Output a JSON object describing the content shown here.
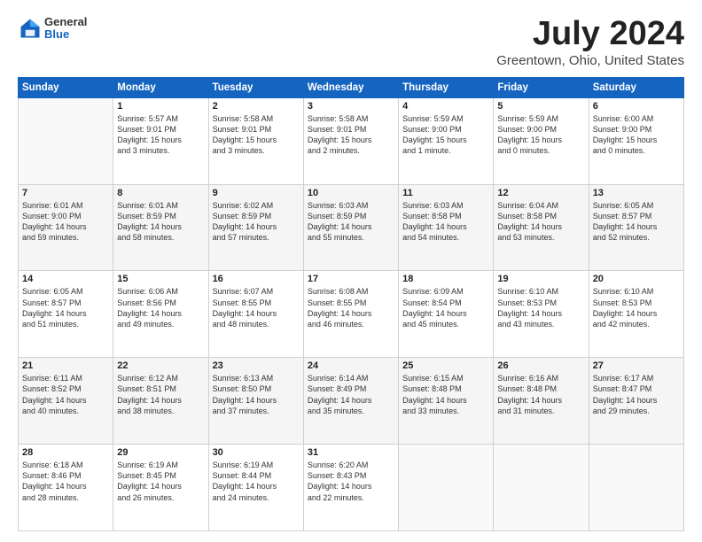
{
  "logo": {
    "general": "General",
    "blue": "Blue"
  },
  "title": "July 2024",
  "subtitle": "Greentown, Ohio, United States",
  "days_of_week": [
    "Sunday",
    "Monday",
    "Tuesday",
    "Wednesday",
    "Thursday",
    "Friday",
    "Saturday"
  ],
  "weeks": [
    [
      {
        "day": "",
        "info": ""
      },
      {
        "day": "1",
        "info": "Sunrise: 5:57 AM\nSunset: 9:01 PM\nDaylight: 15 hours\nand 3 minutes."
      },
      {
        "day": "2",
        "info": "Sunrise: 5:58 AM\nSunset: 9:01 PM\nDaylight: 15 hours\nand 3 minutes."
      },
      {
        "day": "3",
        "info": "Sunrise: 5:58 AM\nSunset: 9:01 PM\nDaylight: 15 hours\nand 2 minutes."
      },
      {
        "day": "4",
        "info": "Sunrise: 5:59 AM\nSunset: 9:00 PM\nDaylight: 15 hours\nand 1 minute."
      },
      {
        "day": "5",
        "info": "Sunrise: 5:59 AM\nSunset: 9:00 PM\nDaylight: 15 hours\nand 0 minutes."
      },
      {
        "day": "6",
        "info": "Sunrise: 6:00 AM\nSunset: 9:00 PM\nDaylight: 15 hours\nand 0 minutes."
      }
    ],
    [
      {
        "day": "7",
        "info": "Sunrise: 6:01 AM\nSunset: 9:00 PM\nDaylight: 14 hours\nand 59 minutes."
      },
      {
        "day": "8",
        "info": "Sunrise: 6:01 AM\nSunset: 8:59 PM\nDaylight: 14 hours\nand 58 minutes."
      },
      {
        "day": "9",
        "info": "Sunrise: 6:02 AM\nSunset: 8:59 PM\nDaylight: 14 hours\nand 57 minutes."
      },
      {
        "day": "10",
        "info": "Sunrise: 6:03 AM\nSunset: 8:59 PM\nDaylight: 14 hours\nand 55 minutes."
      },
      {
        "day": "11",
        "info": "Sunrise: 6:03 AM\nSunset: 8:58 PM\nDaylight: 14 hours\nand 54 minutes."
      },
      {
        "day": "12",
        "info": "Sunrise: 6:04 AM\nSunset: 8:58 PM\nDaylight: 14 hours\nand 53 minutes."
      },
      {
        "day": "13",
        "info": "Sunrise: 6:05 AM\nSunset: 8:57 PM\nDaylight: 14 hours\nand 52 minutes."
      }
    ],
    [
      {
        "day": "14",
        "info": "Sunrise: 6:05 AM\nSunset: 8:57 PM\nDaylight: 14 hours\nand 51 minutes."
      },
      {
        "day": "15",
        "info": "Sunrise: 6:06 AM\nSunset: 8:56 PM\nDaylight: 14 hours\nand 49 minutes."
      },
      {
        "day": "16",
        "info": "Sunrise: 6:07 AM\nSunset: 8:55 PM\nDaylight: 14 hours\nand 48 minutes."
      },
      {
        "day": "17",
        "info": "Sunrise: 6:08 AM\nSunset: 8:55 PM\nDaylight: 14 hours\nand 46 minutes."
      },
      {
        "day": "18",
        "info": "Sunrise: 6:09 AM\nSunset: 8:54 PM\nDaylight: 14 hours\nand 45 minutes."
      },
      {
        "day": "19",
        "info": "Sunrise: 6:10 AM\nSunset: 8:53 PM\nDaylight: 14 hours\nand 43 minutes."
      },
      {
        "day": "20",
        "info": "Sunrise: 6:10 AM\nSunset: 8:53 PM\nDaylight: 14 hours\nand 42 minutes."
      }
    ],
    [
      {
        "day": "21",
        "info": "Sunrise: 6:11 AM\nSunset: 8:52 PM\nDaylight: 14 hours\nand 40 minutes."
      },
      {
        "day": "22",
        "info": "Sunrise: 6:12 AM\nSunset: 8:51 PM\nDaylight: 14 hours\nand 38 minutes."
      },
      {
        "day": "23",
        "info": "Sunrise: 6:13 AM\nSunset: 8:50 PM\nDaylight: 14 hours\nand 37 minutes."
      },
      {
        "day": "24",
        "info": "Sunrise: 6:14 AM\nSunset: 8:49 PM\nDaylight: 14 hours\nand 35 minutes."
      },
      {
        "day": "25",
        "info": "Sunrise: 6:15 AM\nSunset: 8:48 PM\nDaylight: 14 hours\nand 33 minutes."
      },
      {
        "day": "26",
        "info": "Sunrise: 6:16 AM\nSunset: 8:48 PM\nDaylight: 14 hours\nand 31 minutes."
      },
      {
        "day": "27",
        "info": "Sunrise: 6:17 AM\nSunset: 8:47 PM\nDaylight: 14 hours\nand 29 minutes."
      }
    ],
    [
      {
        "day": "28",
        "info": "Sunrise: 6:18 AM\nSunset: 8:46 PM\nDaylight: 14 hours\nand 28 minutes."
      },
      {
        "day": "29",
        "info": "Sunrise: 6:19 AM\nSunset: 8:45 PM\nDaylight: 14 hours\nand 26 minutes."
      },
      {
        "day": "30",
        "info": "Sunrise: 6:19 AM\nSunset: 8:44 PM\nDaylight: 14 hours\nand 24 minutes."
      },
      {
        "day": "31",
        "info": "Sunrise: 6:20 AM\nSunset: 8:43 PM\nDaylight: 14 hours\nand 22 minutes."
      },
      {
        "day": "",
        "info": ""
      },
      {
        "day": "",
        "info": ""
      },
      {
        "day": "",
        "info": ""
      }
    ]
  ]
}
